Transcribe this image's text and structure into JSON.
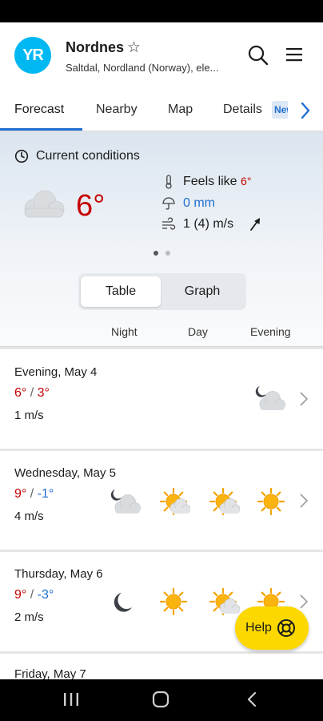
{
  "header": {
    "logo_text": "YR",
    "location_name": "Nordnes",
    "location_detail": "Saltdal, Nordland (Norway), ele...",
    "icons": [
      "star-outline-icon",
      "search-icon",
      "menu-icon"
    ]
  },
  "tabs": {
    "items": [
      {
        "label": "Forecast",
        "active": true
      },
      {
        "label": "Nearby",
        "active": false
      },
      {
        "label": "Map",
        "active": false
      },
      {
        "label": "Details",
        "active": false
      }
    ],
    "badge": "New",
    "accent_color": "#1e6fd0"
  },
  "current": {
    "title": "Current conditions",
    "temperature": "6°",
    "condition_icon": "cloud-icon",
    "feels_like_label": "Feels like",
    "feels_like_value": "6°",
    "precipitation": "0 mm",
    "wind": "1 (4) m/s",
    "page_index": 1,
    "page_count": 2
  },
  "view_toggle": {
    "options": [
      "Table",
      "Graph"
    ],
    "selected": "Table"
  },
  "columns": [
    "Night",
    "Day",
    "Evening"
  ],
  "days": [
    {
      "title": "Evening, May 4",
      "max": "6°",
      "min": "3°",
      "min_warm": true,
      "wind": "1 m/s",
      "icons": [
        "",
        "",
        "partly-cloudy-night-icon"
      ]
    },
    {
      "title": "Wednesday, May 5",
      "max": "9°",
      "min": "-1°",
      "min_warm": false,
      "wind": "4 m/s",
      "icons": [
        "partly-cloudy-night-icon",
        "partly-cloudy-day-icon",
        "partly-cloudy-day-icon",
        "sun-icon"
      ]
    },
    {
      "title": "Thursday, May 6",
      "max": "9°",
      "min": "-3°",
      "min_warm": false,
      "wind": "2 m/s",
      "icons": [
        "moon-icon",
        "sun-icon",
        "partly-cloudy-day-icon",
        "sun-icon"
      ]
    },
    {
      "title": "Friday, May 7"
    }
  ],
  "help_button": {
    "label": "Help"
  },
  "colors": {
    "warm": "#c60000",
    "cold": "#1e6fd0",
    "help": "#fcd800",
    "logo": "#00b8f1"
  }
}
